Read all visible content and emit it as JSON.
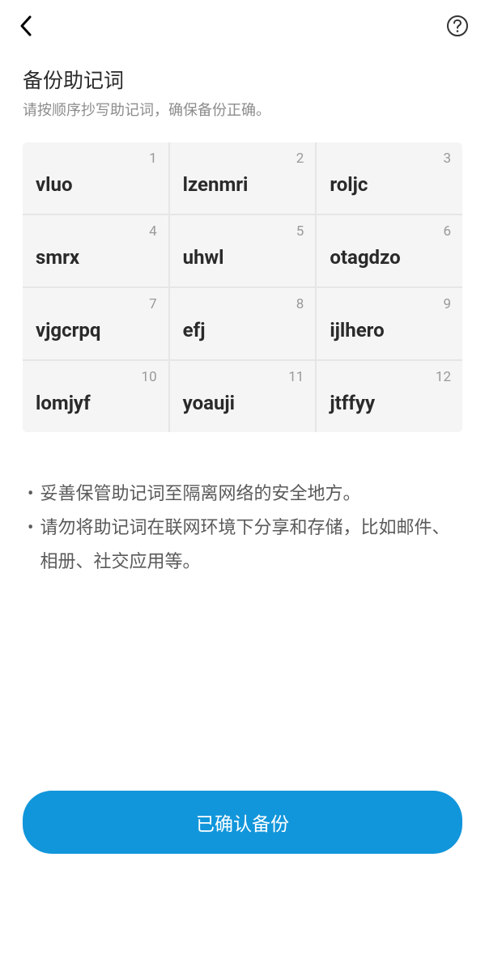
{
  "header": {
    "title": "备份助记词",
    "subtitle": "请按顺序抄写助记词，确保备份正确。"
  },
  "words": [
    {
      "n": "1",
      "w": "vluo"
    },
    {
      "n": "2",
      "w": "lzenmri"
    },
    {
      "n": "3",
      "w": "roljc"
    },
    {
      "n": "4",
      "w": "smrx"
    },
    {
      "n": "5",
      "w": "uhwl"
    },
    {
      "n": "6",
      "w": "otagdzo"
    },
    {
      "n": "7",
      "w": "vjgcrpq"
    },
    {
      "n": "8",
      "w": "efj"
    },
    {
      "n": "9",
      "w": "ijlhero"
    },
    {
      "n": "10",
      "w": "lomjyf"
    },
    {
      "n": "11",
      "w": "yoauji"
    },
    {
      "n": "12",
      "w": "jtffyy"
    }
  ],
  "tips": [
    "妥善保管助记词至隔离网络的安全地方。",
    "请勿将助记词在联网环境下分享和存储，比如邮件、相册、社交应用等。"
  ],
  "button": {
    "confirm_label": "已确认备份"
  }
}
